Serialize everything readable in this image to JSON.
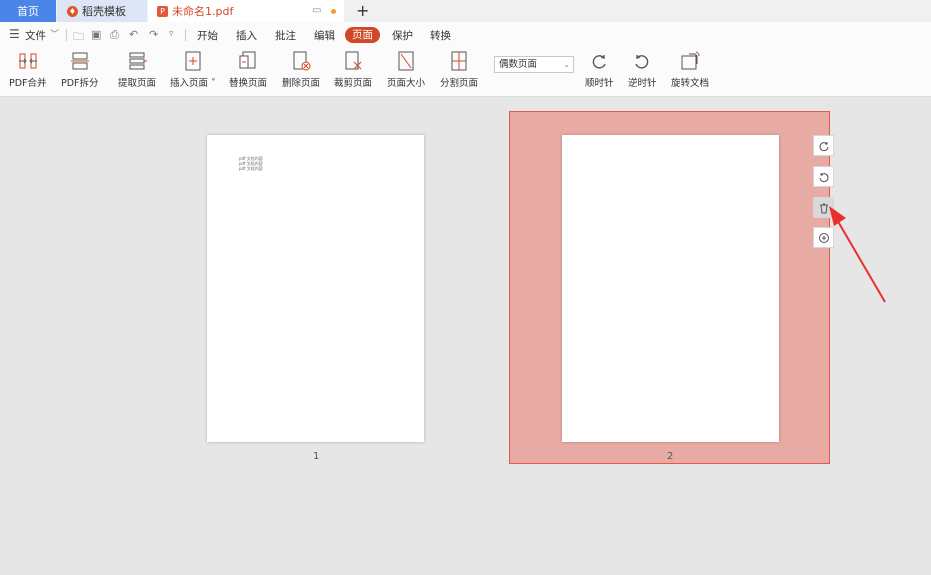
{
  "tabs": {
    "home": "首页",
    "templates": "稻壳模板",
    "document": "未命名1.pdf",
    "new_tab": "+"
  },
  "menu": {
    "file": "文件",
    "items": [
      "开始",
      "插入",
      "批注",
      "编辑",
      "页面",
      "保护",
      "转换"
    ]
  },
  "ribbon": {
    "buttons": [
      "PDF合并",
      "PDF拆分",
      "提取页面",
      "插入页面",
      "替换页面",
      "删除页面",
      "裁剪页面",
      "页面大小",
      "分割页面"
    ],
    "page_select": "偶数页面",
    "rotate": [
      "顺时针",
      "逆时针",
      "旋转文档"
    ]
  },
  "pages": {
    "page1_number": "1",
    "page2_number": "2",
    "page1_text": [
      "pdf 文档内容",
      "pdf 文档内容",
      "pdf 文档内容"
    ]
  },
  "colors": {
    "accent": "#d24726",
    "selection": "#e8aba3",
    "home_tab": "#4a86e8"
  }
}
